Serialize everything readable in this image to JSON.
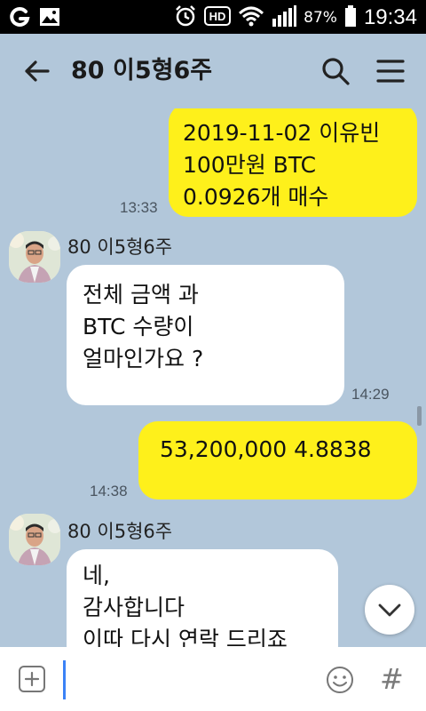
{
  "status_bar": {
    "battery": "87%",
    "time": "19:34",
    "icons": [
      "carrier-g-icon",
      "gallery-icon",
      "alarm-icon",
      "hd-icon",
      "wifi-icon",
      "signal-icon",
      "battery-icon"
    ]
  },
  "header": {
    "title": "80 이5형6주",
    "icons": [
      "back-arrow-icon",
      "search-icon",
      "menu-icon"
    ]
  },
  "messages": [
    {
      "from": "me",
      "text": "2019-11-02 이유빈\n100만원 BTC\n0.0926개 매수",
      "time": "13:33"
    },
    {
      "from": "them",
      "sender": "80 이5형6주",
      "text": "전체 금액 과\nBTC 수량이\n얼마인가요 ?",
      "time": "14:29"
    },
    {
      "from": "me",
      "text": "53,200,000     4.8838",
      "time": "14:38"
    },
    {
      "from": "them",
      "sender": "80 이5형6주",
      "text": "네,\n감사합니다\n이따 다시 연락 드리죠",
      "time": ""
    }
  ],
  "input_bar": {
    "placeholder": "",
    "value": "",
    "hash_label": "#",
    "icons": [
      "plus-icon",
      "emoji-icon"
    ]
  },
  "colors": {
    "chat_background": "#b2c7da",
    "my_bubble": "#fef01b",
    "their_bubble": "#ffffff",
    "status_bar": "#000000"
  }
}
